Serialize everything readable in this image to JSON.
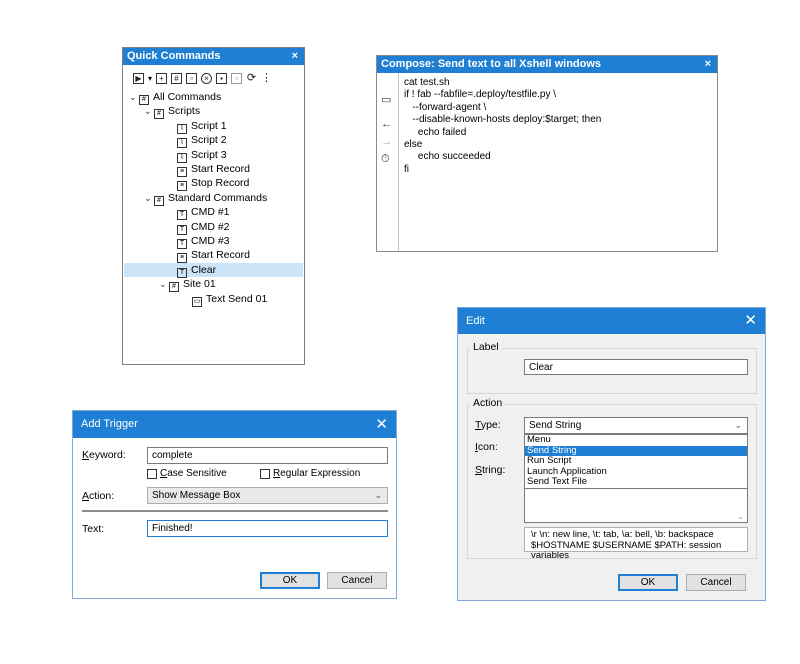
{
  "quick_commands": {
    "title": "Quick Commands",
    "close": "×",
    "toolbar_icons": [
      "play-dropdown-icon",
      "add-icon",
      "add-group-icon",
      "new-file-icon",
      "delete-icon",
      "copy-icon",
      "paste-icon",
      "refresh-icon",
      "more-icon"
    ],
    "tree": [
      {
        "label": "All Commands",
        "level": 0,
        "icon": "group"
      },
      {
        "label": "Scripts",
        "level": 1,
        "icon": "group"
      },
      {
        "label": "Script 1",
        "level": 2,
        "icon": "script"
      },
      {
        "label": "Script 2",
        "level": 2,
        "icon": "script"
      },
      {
        "label": "Script 3",
        "level": 2,
        "icon": "script"
      },
      {
        "label": "Start Record",
        "level": 2,
        "icon": "record"
      },
      {
        "label": "Stop Record",
        "level": 2,
        "icon": "record"
      },
      {
        "label": "Standard Commands",
        "level": 1,
        "icon": "group"
      },
      {
        "label": "CMD #1",
        "level": 2,
        "icon": "text"
      },
      {
        "label": "CMD #2",
        "level": 2,
        "icon": "text"
      },
      {
        "label": "CMD #3",
        "level": 2,
        "icon": "text"
      },
      {
        "label": "Start Record",
        "level": 2,
        "icon": "record"
      },
      {
        "label": "Clear",
        "level": 2,
        "icon": "text",
        "selected": true
      },
      {
        "label": "Site 01",
        "level": 2,
        "icon": "group"
      },
      {
        "label": "Text Send 01",
        "level": 3,
        "icon": "file"
      }
    ]
  },
  "compose": {
    "title": "Compose: Send text to all Xshell windows",
    "close": "×",
    "lines": [
      "cat test.sh",
      "if ! fab --fabfile=.deploy/testfile.py \\",
      "   --forward-agent \\",
      "   --disable-known-hosts deploy:$target; then",
      "     echo failed",
      "else",
      "     echo succeeded",
      "fi"
    ]
  },
  "add_trigger": {
    "title": "Add Trigger",
    "close": "✕",
    "keyword_label": "Keyword:",
    "keyword_value": "complete",
    "case_sensitive": "Case Sensitive",
    "regex": "Regular Expression",
    "action_label": "Action:",
    "action_value": "Show Message Box",
    "text_label": "Text:",
    "text_value": "Finished!",
    "ok": "OK",
    "cancel": "Cancel"
  },
  "edit": {
    "title": "Edit",
    "close": "✕",
    "label_group": "Label",
    "label_value": "Clear",
    "action_group": "Action",
    "type_label": "Type:",
    "type_value": "Send String",
    "icon_label": "Icon:",
    "string_label": "String:",
    "options": [
      "Menu",
      "Send String",
      "Run Script",
      "Launch Application",
      "Send Text File"
    ],
    "selected_option": 1,
    "hint_line1": "\\r \\n: new line, \\t: tab, \\a: bell, \\b: backspace",
    "hint_line2": "$HOSTNAME $USERNAME $PATH: session variables",
    "ok": "OK",
    "cancel": "Cancel"
  },
  "colors": {
    "accent": "#1e7fd4",
    "selection": "#cce4f7"
  }
}
